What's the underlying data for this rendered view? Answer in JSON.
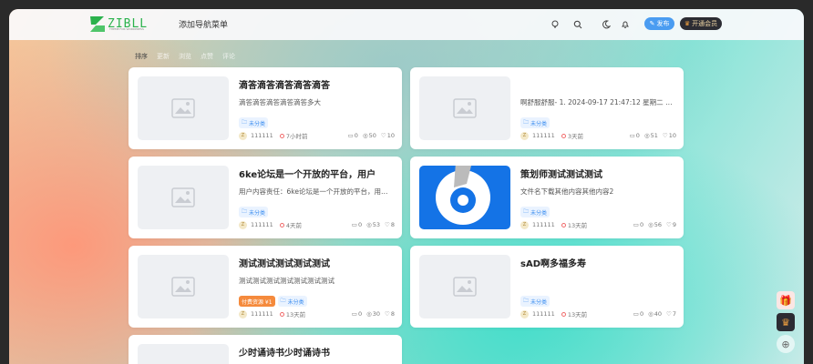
{
  "header": {
    "logo_text": "ZIBLL",
    "logo_sub": "THEME FOR WORDPRESS",
    "nav_link": "添加导航菜单",
    "publish_label": "发布",
    "vip_label": "开通会员"
  },
  "tabs": [
    "排序",
    "更新",
    "浏览",
    "点赞",
    "评论"
  ],
  "cards": [
    {
      "title": "滴答滴答滴答滴答滴答",
      "excerpt": "滴答滴答滴答滴答滴答多大",
      "tags": [
        "未分类"
      ],
      "paid": "",
      "author": "111111",
      "time": "7小时前",
      "comments": "0",
      "views": "50",
      "likes": "10"
    },
    {
      "title": "",
      "excerpt": "啊舒服舒服- 1. 2024-09-17 21:47:12 星期二 2024-...",
      "tags": [
        "未分类"
      ],
      "paid": "",
      "author": "111111",
      "time": "3天前",
      "comments": "0",
      "views": "51",
      "likes": "10"
    },
    {
      "title": "6ke论坛是一个开放的平台，用户",
      "excerpt": "用户内容责任：6ke论坛是一个开放的平台，用户...",
      "tags": [
        "未分类"
      ],
      "paid": "",
      "author": "111111",
      "time": "4天前",
      "comments": "0",
      "views": "53",
      "likes": "8"
    },
    {
      "title": "策划师测试测试测试",
      "excerpt": "文件名下载其他内容其他内容2",
      "tags": [
        "未分类"
      ],
      "paid": "",
      "author": "111111",
      "time": "13天前",
      "comments": "0",
      "views": "56",
      "likes": "9"
    },
    {
      "title": "测试测试测试测试测试",
      "excerpt": "测试测试测试测试测试测试测试",
      "tags": [
        "未分类"
      ],
      "paid": "付费资源 ¥1",
      "author": "111111",
      "time": "13天前",
      "comments": "0",
      "views": "30",
      "likes": "8"
    },
    {
      "title": "sAD啊多福多寿",
      "excerpt": "",
      "tags": [
        "未分类"
      ],
      "paid": "",
      "author": "111111",
      "time": "13天前",
      "comments": "0",
      "views": "40",
      "likes": "7"
    },
    {
      "title": "少时诵诗书少时诵诗书",
      "excerpt": "",
      "tags": [],
      "paid": "",
      "author": "",
      "time": "",
      "comments": "",
      "views": "",
      "likes": ""
    }
  ],
  "colors": {
    "accent": "#4a9cf1",
    "brand_green": "#2bb24c",
    "vip_bg": "#2c2c33",
    "thumb_blue": "#1473e6"
  }
}
